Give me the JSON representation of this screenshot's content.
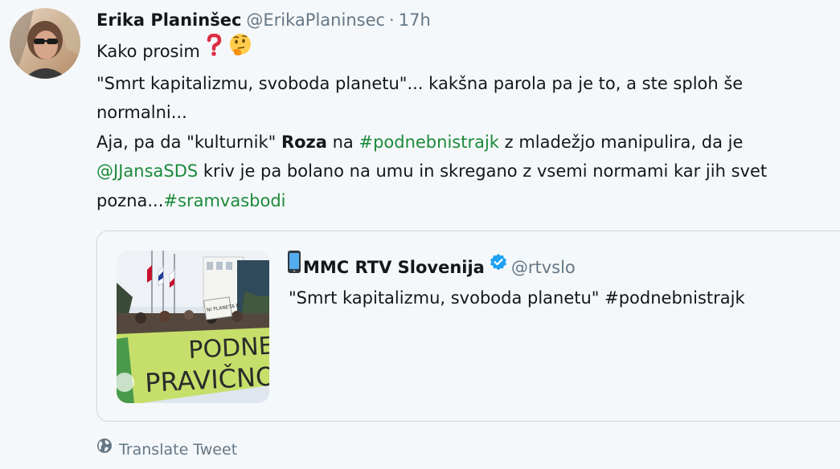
{
  "tweet": {
    "author_name": "Erika Planinšec",
    "author_handle": "@ErikaPlaninsec",
    "separator": "·",
    "time": "17h",
    "avatar_icon": "user-avatar-photo",
    "line1_text": "Kako prosim",
    "line1_emojis": [
      "red-question-mark-emoji",
      "thinking-face-emoji"
    ],
    "line2_text": "\"Smrt kapitalizmu, svoboda planetu\"... kakšna parola pa je to, a ste sploh še",
    "line3_text": "normalni...",
    "line4_before": "Aja, pa da \"kulturnik\" ",
    "line4_bold": "Roza",
    "line4_mid": " na ",
    "line4_hashtag": "#podnebnistrajk",
    "line4_after": " z mladežjo manipulira, da je",
    "line5_mention": "@JJansaSDS",
    "line5_after": " kriv je pa bolano na umu in skregano z vsemi normami kar jih svet",
    "line6_before": "pozna...",
    "line6_hashtag": "#sramvasbodi",
    "link_color": "#1b8a3a"
  },
  "quote": {
    "account_icon": "mobile-phone-icon",
    "name": "MMC RTV Slovenija",
    "verified_icon": "verified-badge-icon",
    "verified_color": "#1da1f2",
    "handle": "@rtvslo",
    "text": "\"Smrt kapitalizmu, svoboda planetu\" #podnebnistrajk",
    "image_banner_line1": "PODNE",
    "image_banner_line2": "PRAVIČNO",
    "image_sign_text": "NI PLANETA B"
  },
  "translate": {
    "icon": "globe-icon",
    "label": "Translate Tweet"
  }
}
